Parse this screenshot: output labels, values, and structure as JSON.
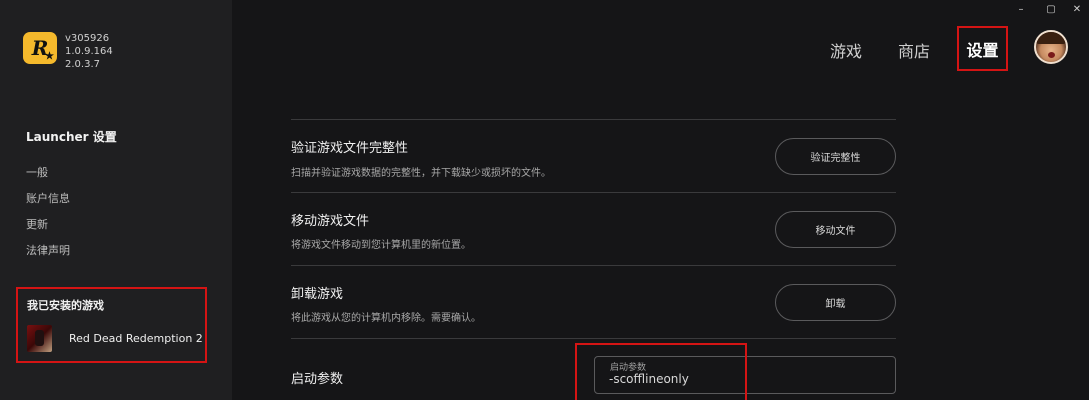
{
  "window": {
    "controls": [
      "–",
      "▢",
      "✕"
    ]
  },
  "app": {
    "logo_text": "R",
    "logo_star": "★",
    "versions": [
      "v305926",
      "1.0.9.164",
      "2.0.3.7"
    ]
  },
  "sidebar": {
    "title": "Launcher 设置",
    "items": [
      {
        "label": "一般"
      },
      {
        "label": "账户信息"
      },
      {
        "label": "更新"
      },
      {
        "label": "法律声明"
      }
    ],
    "installed_games_title": "我已安装的游戏",
    "games": [
      {
        "name": "Red Dead Redemption 2"
      }
    ]
  },
  "topnav": {
    "games": "游戏",
    "store": "商店",
    "settings": "设置"
  },
  "settings": {
    "rows": [
      {
        "title": "验证游戏文件完整性",
        "description": "扫描并验证游戏数据的完整性，并下载缺少或损坏的文件。",
        "button": "验证完整性"
      },
      {
        "title": "移动游戏文件",
        "description": "将游戏文件移动到您计算机里的新位置。",
        "button": "移动文件"
      },
      {
        "title": "卸载游戏",
        "description": "将此游戏从您的计算机内移除。需要确认。",
        "button": "卸载"
      }
    ],
    "launch_args": {
      "title": "启动参数",
      "field_label": "启动参数",
      "value": "-scofflineonly"
    }
  },
  "colors": {
    "accent_highlight": "#d41414",
    "logo_yellow": "#f5b92c",
    "sidebar_bg": "#1f1f21",
    "main_bg": "#151517"
  }
}
